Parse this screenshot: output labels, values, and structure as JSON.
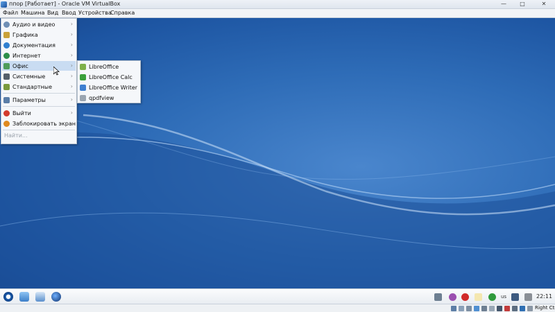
{
  "window": {
    "title": "ппор [Работает] - Oracle VM VirtualBox",
    "controls": {
      "minimize": "—",
      "maximize": "□",
      "close": "✕"
    }
  },
  "menubar": [
    "Файл",
    "Машина",
    "Вид",
    "Ввод",
    "Устройства",
    "Справка"
  ],
  "start_menu": {
    "items": [
      {
        "label": "Аудио и видео",
        "icon": "multimedia-icon",
        "color": "#6f8fb5"
      },
      {
        "label": "Графика",
        "icon": "graphics-icon",
        "color": "#c9a23a"
      },
      {
        "label": "Документация",
        "icon": "documentation-icon",
        "color": "#2f7fd0"
      },
      {
        "label": "Интернет",
        "icon": "internet-icon",
        "color": "#2d8f4a"
      },
      {
        "label": "Офис",
        "icon": "office-icon",
        "color": "#4d9c5a"
      },
      {
        "label": "Системные",
        "icon": "system-icon",
        "color": "#555f6b"
      },
      {
        "label": "Стандартные",
        "icon": "accessories-icon",
        "color": "#7a9a3d"
      },
      {
        "label": "Параметры",
        "icon": "settings-icon",
        "color": "#5a7ea8"
      },
      {
        "label": "Выйти",
        "icon": "logout-icon",
        "color": "#d23b2e"
      },
      {
        "label": "Заблокировать экран",
        "icon": "lock-screen-icon",
        "color": "#e08a1f"
      }
    ],
    "arrow": "›",
    "search_placeholder": "Найти..."
  },
  "submenu": {
    "items": [
      {
        "label": "LibreOffice",
        "icon": "libreoffice-icon",
        "color": "#7fb04a"
      },
      {
        "label": "LibreOffice Calc",
        "icon": "libreoffice-calc-icon",
        "color": "#3aa03a"
      },
      {
        "label": "LibreOffice Writer",
        "icon": "libreoffice-writer-icon",
        "color": "#3e7fd0"
      },
      {
        "label": "qpdfview",
        "icon": "qpdfview-icon",
        "color": "#9aa5b1"
      }
    ]
  },
  "taskbar": {
    "keyboard_layout": "us",
    "clock": "22:11"
  },
  "statusbar": {
    "host_key": "Right Ctrl"
  },
  "colors": {
    "desktop": "#2e6cb7",
    "menu_highlight": "#c9dcf2"
  }
}
